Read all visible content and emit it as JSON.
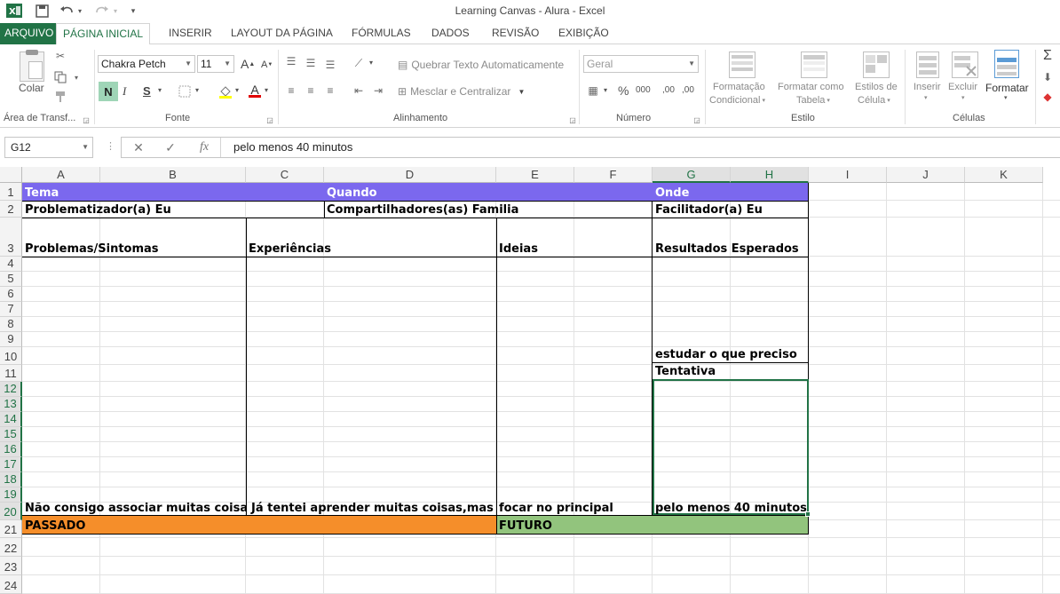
{
  "app": {
    "title": "Learning Canvas - Alura - Excel"
  },
  "tabs": [
    "ARQUIVO",
    "PÁGINA INICIAL",
    "INSERIR",
    "LAYOUT DA PÁGINA",
    "FÓRMULAS",
    "DADOS",
    "REVISÃO",
    "EXIBIÇÃO"
  ],
  "ribbon": {
    "clipboard": {
      "paste_label": "Colar",
      "group_label": "Área de Transf..."
    },
    "font": {
      "font_name": "Chakra Petch",
      "font_size": "11",
      "bold": "N",
      "italic": "I",
      "underline": "S",
      "color_letter": "A",
      "grow": "A",
      "shrink": "A",
      "group_label": "Fonte"
    },
    "alignment": {
      "wrap_text": "Quebrar Texto Automaticamente",
      "merge_center": "Mesclar e Centralizar",
      "group_label": "Alinhamento"
    },
    "number": {
      "format": "Geral",
      "percent": "%",
      "thousands": "000",
      "inc_decimal": ",00",
      "dec_decimal": ",00",
      "group_label": "Número"
    },
    "styles": {
      "conditional": "Formatação",
      "conditional2": "Condicional",
      "as_table": "Formatar como",
      "as_table2": "Tabela",
      "cell_styles": "Estilos de",
      "cell_styles2": "Célula",
      "group_label": "Estilo"
    },
    "cells": {
      "insert": "Inserir",
      "delete": "Excluir",
      "format": "Formatar",
      "group_label": "Células"
    }
  },
  "formula_bar": {
    "name_box": "G12",
    "fx": "fx",
    "content": "pelo menos 40 minutos"
  },
  "columns": [
    "A",
    "B",
    "C",
    "D",
    "E",
    "F",
    "G",
    "H",
    "I",
    "J",
    "K"
  ],
  "rows": [
    "1",
    "2",
    "3",
    "4",
    "5",
    "6",
    "7",
    "8",
    "9",
    "10",
    "11",
    "12",
    "13",
    "14",
    "15",
    "16",
    "17",
    "18",
    "19",
    "20",
    "21",
    "22",
    "23",
    "24"
  ],
  "cells": {
    "A1": "Tema",
    "D1": "Quando",
    "G1": "Onde",
    "A2": "Problematizador(a) Eu",
    "D2": "Compartilhadores(as) Familia",
    "G2": "Facilitador(a) Eu",
    "A3": "Problemas/Sintomas",
    "C3": "Experiências",
    "E3": "Ideias",
    "G3": "Resultados Esperados",
    "G10": "estudar o que preciso",
    "G11": "Tentativa",
    "A20": "Não consigo associar muitas coisas",
    "C20": "Já tentei aprender muitas coisas,mas tudo",
    "E20": "focar no principal",
    "G20": "pelo menos 40 minutos",
    "A21": "PASSADO",
    "E21": "FUTURO"
  },
  "colors": {
    "excel_green": "#217346",
    "header_purple": "#7b68ee",
    "past_orange": "#f58e2a",
    "future_green": "#92c47d"
  }
}
